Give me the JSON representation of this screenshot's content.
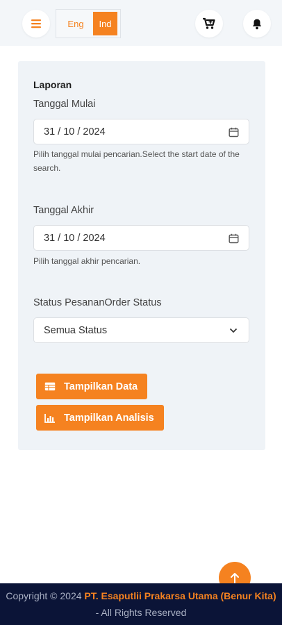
{
  "header": {
    "menu_icon": "hamburger-menu-icon",
    "lang_eng": "Eng",
    "lang_ind": "Ind",
    "cart_icon": "cart-icon",
    "bell_icon": "bell-icon",
    "accent_color": "#f58220"
  },
  "form": {
    "title": "Laporan",
    "start_label": "Tanggal Mulai",
    "start_value": "31 / 10 / 2024",
    "start_help": "Pilih tanggal mulai pencarian.Select the start date of the search.",
    "end_label": "Tanggal Akhir",
    "end_value": "31 / 10 / 2024",
    "end_help": "Pilih tanggal akhir pencarian.",
    "status_label": "Status PesananOrder Status",
    "status_value": "Semua Status",
    "calendar_icon": "calendar-icon",
    "dropdown_icon": "chevron-down-icon"
  },
  "actions": {
    "show_data": "Tampilkan Data",
    "show_data_icon": "table-icon",
    "show_analysis": "Tampilkan Analisis",
    "show_analysis_icon": "bar-chart-icon"
  },
  "scroll_top_icon": "arrow-up-icon",
  "footer": {
    "prefix": "Copyright © 2024 ",
    "company": "PT. Esaputlii Prakarsa Utama (Benur Kita)",
    "suffix": " - All Rights Reserved",
    "background": "#0b1437"
  }
}
